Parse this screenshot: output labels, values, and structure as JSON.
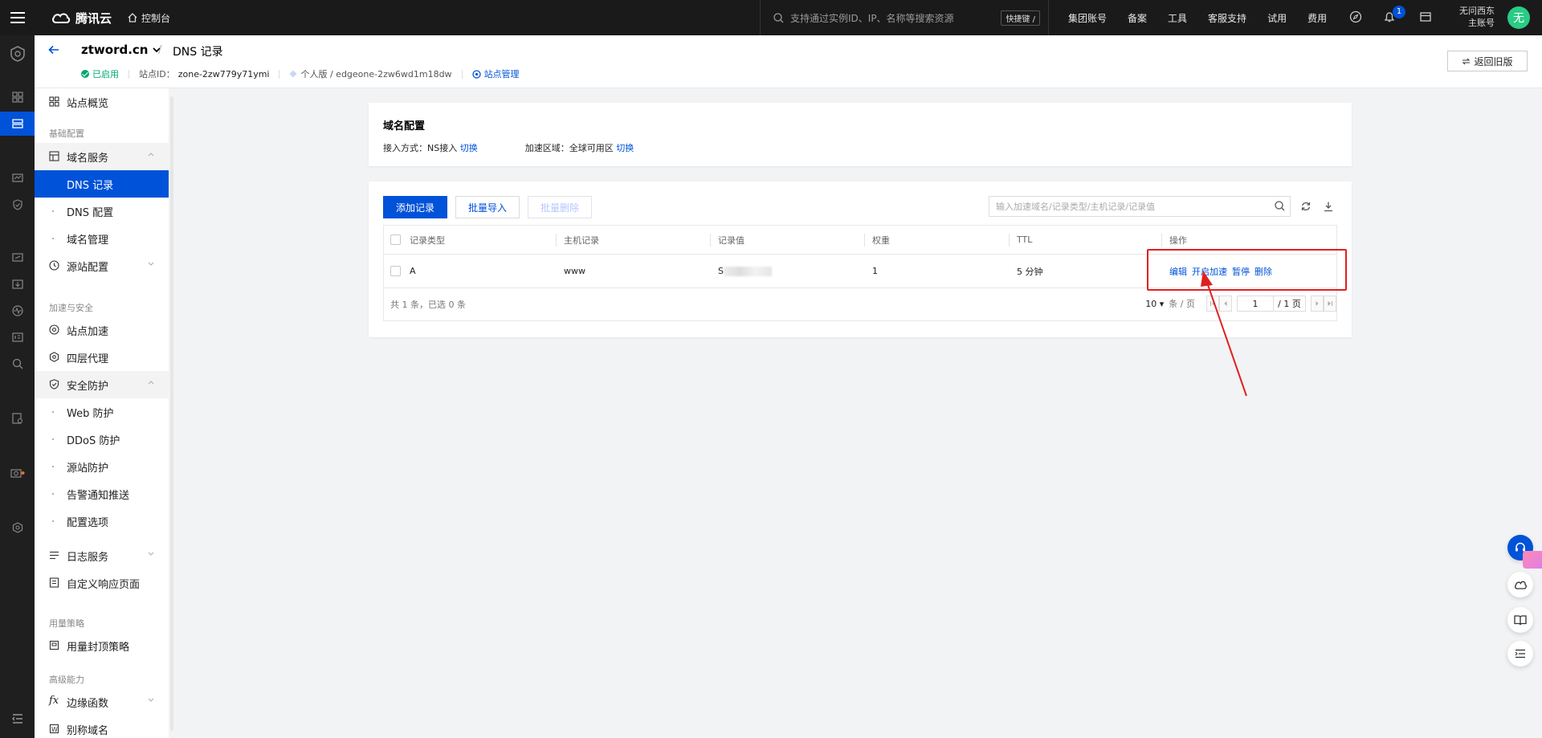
{
  "topbar": {
    "brand": "腾讯云",
    "console": "控制台",
    "search_placeholder": "支持通过实例ID、IP、名称等搜索资源",
    "shortcut": "快捷键 /",
    "nav": [
      "集团账号",
      "备案",
      "工具",
      "客服支持",
      "试用",
      "费用"
    ],
    "notification_count": "1",
    "user_name": "无问西东",
    "user_role": "主账号",
    "avatar_text": "无"
  },
  "header": {
    "domain": "ztword.cn",
    "crumb_sep": "/",
    "crumb": "DNS 记录",
    "status": "已启用",
    "site_id_label": "站点ID：",
    "site_id": "zone-2zw779y71ymi",
    "plan": "个人版 / edgeone-2zw6wd1m18dw",
    "site_manage": "站点管理",
    "old_version": "返回旧版"
  },
  "sidebar": {
    "overview": "站点概览",
    "section_basic": "基础配置",
    "domain_service": "域名服务",
    "dns_records": "DNS 记录",
    "dns_config": "DNS 配置",
    "domain_manage": "域名管理",
    "origin_config": "源站配置",
    "section_accel": "加速与安全",
    "site_accel": "站点加速",
    "l4_proxy": "四层代理",
    "security": "安全防护",
    "web_protect": "Web 防护",
    "ddos_protect": "DDoS 防护",
    "origin_protect": "源站防护",
    "alert_push": "告警通知推送",
    "config_options": "配置选项",
    "log_service": "日志服务",
    "custom_page": "自定义响应页面",
    "section_usage": "用量策略",
    "usage_cap": "用量封顶策略",
    "section_advanced": "高级能力",
    "edge_func": "边缘函数",
    "alias_domain": "别称域名"
  },
  "domain_config": {
    "title": "域名配置",
    "access_label": "接入方式：",
    "access_value": "NS接入",
    "switch1": "切换",
    "region_label": "加速区域：",
    "region_value": "全球可用区",
    "switch2": "切换"
  },
  "records": {
    "add": "添加记录",
    "import": "批量导入",
    "delete": "批量删除",
    "search_placeholder": "输入加速域名/记录类型/主机记录/记录值",
    "columns": [
      "记录类型",
      "主机记录",
      "记录值",
      "权重",
      "TTL",
      "操作"
    ],
    "rows": [
      {
        "type": "A",
        "host": "www",
        "value_prefix": "S",
        "weight": "1",
        "ttl": "5 分钟",
        "ops": [
          "编辑",
          "开启加速",
          "暂停",
          "删除"
        ]
      }
    ],
    "summary": "共 1 条，已选 0 条",
    "page_size": "10",
    "page_size_unit": "条 / 页",
    "page": "1",
    "total_pages": "/ 1 页"
  },
  "colors": {
    "brand_blue": "#0052d9",
    "highlight_red": "#e02020",
    "topbar_bg": "#1a1a1a",
    "success_green": "#00a870"
  }
}
